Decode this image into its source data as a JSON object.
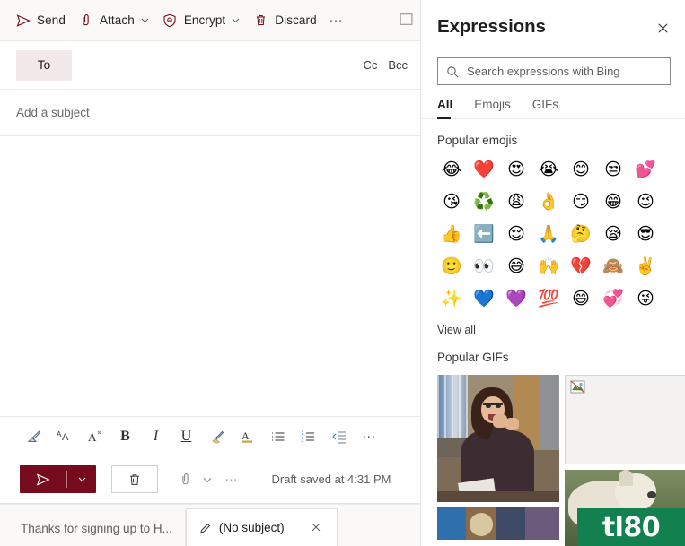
{
  "compose": {
    "toolbar": {
      "send_label": "Send",
      "attach_label": "Attach",
      "encrypt_label": "Encrypt",
      "discard_label": "Discard",
      "more_label": "…"
    },
    "recipients": {
      "to_label": "To",
      "cc_label": "Cc",
      "bcc_label": "Bcc"
    },
    "subject_placeholder": "Add a subject",
    "format_toolbar": {
      "items": [
        {
          "name": "format-painter",
          "label": "Format painter"
        },
        {
          "name": "font-size",
          "label": "Font size"
        },
        {
          "name": "clear-formatting",
          "label": "Clear formatting"
        },
        {
          "name": "bold",
          "label": "B"
        },
        {
          "name": "italic",
          "label": "I"
        },
        {
          "name": "underline",
          "label": "U"
        },
        {
          "name": "highlight",
          "label": "Highlight"
        },
        {
          "name": "font-color",
          "label": "A"
        },
        {
          "name": "bulleted-list",
          "label": "Bulleted list"
        },
        {
          "name": "numbered-list",
          "label": "Numbered list"
        },
        {
          "name": "decrease-indent",
          "label": "Decrease indent"
        },
        {
          "name": "more-formatting",
          "label": "…"
        }
      ]
    },
    "actions": {
      "draft_status": "Draft saved at 4:31 PM",
      "more_label": "…"
    },
    "tabs": [
      {
        "label": "Thanks for signing up to H...",
        "active": false,
        "closable": false
      },
      {
        "label": "(No subject)",
        "active": true,
        "closable": true
      }
    ]
  },
  "panel": {
    "title": "Expressions",
    "search": {
      "placeholder": "Search expressions with Bing",
      "value": ""
    },
    "tabs": [
      {
        "label": "All",
        "selected": true
      },
      {
        "label": "Emojis",
        "selected": false
      },
      {
        "label": "GIFs",
        "selected": false
      }
    ],
    "emoji_section": {
      "title": "Popular emojis",
      "view_all_label": "View all",
      "emojis": [
        {
          "glyph": "😂",
          "name": "face-with-tears-of-joy"
        },
        {
          "glyph": "❤️",
          "name": "red-heart"
        },
        {
          "glyph": "😍",
          "name": "smiling-face-with-heart-eyes"
        },
        {
          "glyph": "😭",
          "name": "loudly-crying-face"
        },
        {
          "glyph": "😊",
          "name": "smiling-face-with-smiling-eyes"
        },
        {
          "glyph": "😒",
          "name": "unamused-face"
        },
        {
          "glyph": "💕",
          "name": "two-hearts"
        },
        {
          "glyph": "😘",
          "name": "face-blowing-a-kiss"
        },
        {
          "glyph": "♻️",
          "name": "recycling-symbol"
        },
        {
          "glyph": "😩",
          "name": "weary-face"
        },
        {
          "glyph": "👌",
          "name": "ok-hand"
        },
        {
          "glyph": "😏",
          "name": "smirking-face"
        },
        {
          "glyph": "😁",
          "name": "beaming-face-with-smiling-eyes"
        },
        {
          "glyph": "😉",
          "name": "winking-face"
        },
        {
          "glyph": "👍",
          "name": "thumbs-up"
        },
        {
          "glyph": "⬅️",
          "name": "left-arrow"
        },
        {
          "glyph": "😌",
          "name": "relieved-face"
        },
        {
          "glyph": "🙏",
          "name": "folded-hands"
        },
        {
          "glyph": "🤔",
          "name": "thinking-face"
        },
        {
          "glyph": "😪",
          "name": "sleepy-face"
        },
        {
          "glyph": "😎",
          "name": "smiling-face-with-sunglasses"
        },
        {
          "glyph": "🙂",
          "name": "slightly-smiling-face"
        },
        {
          "glyph": "👀",
          "name": "eyes"
        },
        {
          "glyph": "😅",
          "name": "grinning-face-with-sweat"
        },
        {
          "glyph": "🙌",
          "name": "raising-hands"
        },
        {
          "glyph": "💔",
          "name": "broken-heart"
        },
        {
          "glyph": "🙈",
          "name": "see-no-evil-monkey"
        },
        {
          "glyph": "✌️",
          "name": "victory-hand"
        },
        {
          "glyph": "✨",
          "name": "sparkles"
        },
        {
          "glyph": "💙",
          "name": "blue-heart"
        },
        {
          "glyph": "💜",
          "name": "purple-heart"
        },
        {
          "glyph": "💯",
          "name": "hundred-points"
        },
        {
          "glyph": "😄",
          "name": "grinning-face-with-smiling-eyes"
        },
        {
          "glyph": "💞",
          "name": "revolving-hearts"
        },
        {
          "glyph": "😜",
          "name": "winking-face-with-tongue"
        }
      ]
    },
    "gif_section": {
      "title": "Popular GIFs",
      "items": [
        {
          "name": "gif-woman-celebrating"
        },
        {
          "name": "gif-broken-placeholder"
        },
        {
          "name": "gif-animal"
        },
        {
          "name": "gif-partial-bottom"
        }
      ]
    }
  },
  "watermark": {
    "text": "tl80"
  },
  "colors": {
    "accent": "#750b1c",
    "panel_border": "#e6e4e1",
    "toolbar_bg": "#faf9f8",
    "watermark_bg": "#12814f"
  }
}
